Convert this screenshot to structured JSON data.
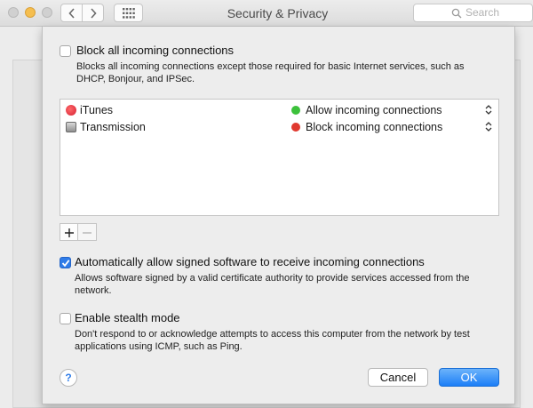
{
  "window": {
    "title": "Security & Privacy",
    "search_placeholder": "Search"
  },
  "firewall_options": {
    "block_all": {
      "label": "Block all incoming connections",
      "description": "Blocks all incoming connections except those required for basic Internet services,  such as DHCP, Bonjour, and IPSec.",
      "checked": false
    },
    "apps": [
      {
        "name": "iTunes",
        "status": "Allow incoming connections",
        "status_color": "#3cc13b",
        "icon": "itunes-icon"
      },
      {
        "name": "Transmission",
        "status": "Block incoming connections",
        "status_color": "#e0392f",
        "icon": "transmission-icon"
      }
    ],
    "auto_allow_signed": {
      "label": "Automatically allow signed software to receive incoming connections",
      "description": "Allows software signed by a valid certificate authority to provide services accessed from the network.",
      "checked": true
    },
    "stealth_mode": {
      "label": "Enable stealth mode",
      "description": "Don't respond to or acknowledge attempts to access this computer from the network by test applications using ICMP, such as Ping.",
      "checked": false
    }
  },
  "buttons": {
    "help": "?",
    "cancel": "Cancel",
    "ok": "OK"
  },
  "colors": {
    "accent": "#2f7ce8"
  }
}
